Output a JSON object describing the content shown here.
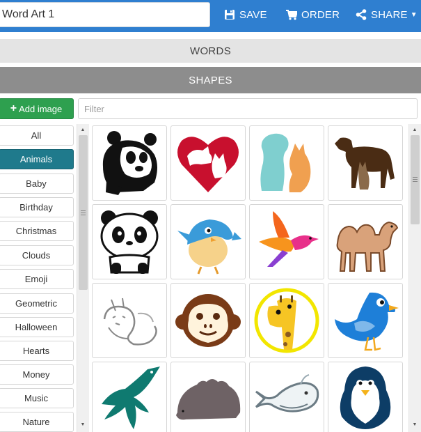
{
  "header": {
    "title_value": "Word Art 1",
    "save_label": "SAVE",
    "order_label": "ORDER",
    "share_label": "SHARE"
  },
  "sections": {
    "words": "WORDS",
    "shapes": "SHAPES"
  },
  "toolbar": {
    "add_image_label": "Add image",
    "filter_placeholder": "Filter"
  },
  "categories": [
    {
      "label": "All",
      "active": false
    },
    {
      "label": "Animals",
      "active": true
    },
    {
      "label": "Baby",
      "active": false
    },
    {
      "label": "Birthday",
      "active": false
    },
    {
      "label": "Christmas",
      "active": false
    },
    {
      "label": "Clouds",
      "active": false
    },
    {
      "label": "Emoji",
      "active": false
    },
    {
      "label": "Geometric",
      "active": false
    },
    {
      "label": "Halloween",
      "active": false
    },
    {
      "label": "Hearts",
      "active": false
    },
    {
      "label": "Money",
      "active": false
    },
    {
      "label": "Music",
      "active": false
    },
    {
      "label": "Nature",
      "active": false
    }
  ],
  "shapes": [
    {
      "icon": "panda-wwf-icon"
    },
    {
      "icon": "heart-dog-cat-icon"
    },
    {
      "icon": "dog-cat-silhouette-icon"
    },
    {
      "icon": "dog-cat-brown-icon"
    },
    {
      "icon": "panda-cartoon-icon"
    },
    {
      "icon": "blue-bird-icon"
    },
    {
      "icon": "flying-bird-icon"
    },
    {
      "icon": "camel-icon"
    },
    {
      "icon": "cat-sketch-icon"
    },
    {
      "icon": "monkey-icon"
    },
    {
      "icon": "giraffe-icon"
    },
    {
      "icon": "blue-bird-standing-icon"
    },
    {
      "icon": "teal-bird-icon"
    },
    {
      "icon": "hedgehog-icon"
    },
    {
      "icon": "whale-icon"
    },
    {
      "icon": "penguin-icon"
    }
  ],
  "colors": {
    "topbar": "#2f7fd0",
    "add_button": "#2ea04f",
    "active_category": "#1f7a8c",
    "shapes_header": "#8d8d8d",
    "words_header": "#e4e4e4"
  }
}
